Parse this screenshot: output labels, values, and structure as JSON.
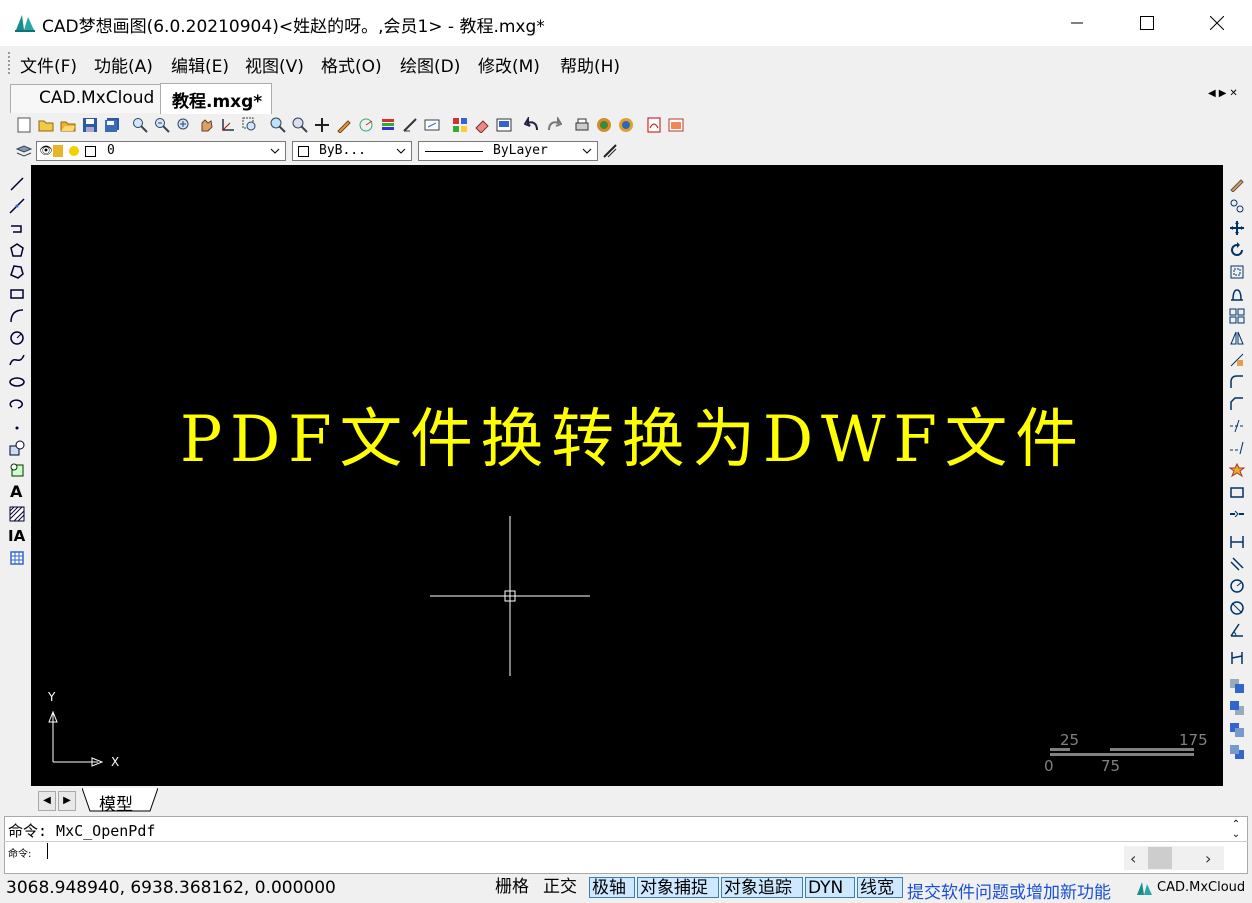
{
  "window": {
    "title": "CAD梦想画图(6.0.20210904)<姓赵的呀。,会员1> - 教程.mxg*"
  },
  "menu": [
    "文件(F)",
    "功能(A)",
    "编辑(E)",
    "视图(V)",
    "格式(O)",
    "绘图(D)",
    "修改(M)",
    "帮助(H)"
  ],
  "tabs": [
    "CAD.MxCloud",
    "教程.mxg*"
  ],
  "properties": {
    "layer": "0",
    "color": "ByB...",
    "linetype": "ByLayer"
  },
  "drawing": {
    "text": "PDF文件换转换为DWF文件",
    "text_color": "#ffff00",
    "background": "#000000",
    "ucs_y": "Y",
    "ucs_x": "X",
    "scale_top": [
      "25",
      "175"
    ],
    "scale_bottom": [
      "0",
      "75"
    ]
  },
  "layout_tab": "模型",
  "command": {
    "history": "命令: MxC_OpenPdf",
    "prompt": "命令:"
  },
  "status": {
    "coordinates": "3068.948940,  6938.368162,  0.000000",
    "toggles": [
      {
        "label": "栅格",
        "on": false
      },
      {
        "label": "正交",
        "on": false
      },
      {
        "label": "极轴",
        "on": true
      },
      {
        "label": "对象捕捉",
        "on": true
      },
      {
        "label": "对象追踪",
        "on": true
      },
      {
        "label": "DYN",
        "on": true
      },
      {
        "label": "线宽",
        "on": true
      }
    ],
    "feedback": "提交软件问题或增加新功能",
    "brand": "CAD.MxCloud"
  },
  "icons": {
    "left_toolbar": [
      "line-icon",
      "xline-icon",
      "polyline-icon",
      "polygon-icon",
      "polygon2-icon",
      "rectangle-icon",
      "arc-icon",
      "circle-icon",
      "spline-icon",
      "ellipse-icon",
      "ellipse-arc-icon",
      "point-icon",
      "insert-block-icon",
      "make-block-icon",
      "text-icon",
      "hatch-icon",
      "mtext-icon",
      "table-icon"
    ],
    "right_toolbar": [
      "erase-icon",
      "copy-icon",
      "move-icon",
      "rotate-icon",
      "offset-icon",
      "stretch-icon",
      "array-icon",
      "mirror-icon",
      "scale-icon",
      "fillet-icon",
      "chamfer-icon",
      "trim-icon",
      "extend-icon",
      "explode-icon",
      "rectangle-edit-icon",
      "join-icon",
      "dim-linear-icon",
      "dim-aligned-icon",
      "dim-radius-icon",
      "dim-diameter-icon",
      "dim-angle-icon",
      "dim-baseline-icon",
      "draworder-front-icon",
      "draworder-back-icon",
      "draworder-above-icon",
      "draworder-under-icon"
    ]
  }
}
